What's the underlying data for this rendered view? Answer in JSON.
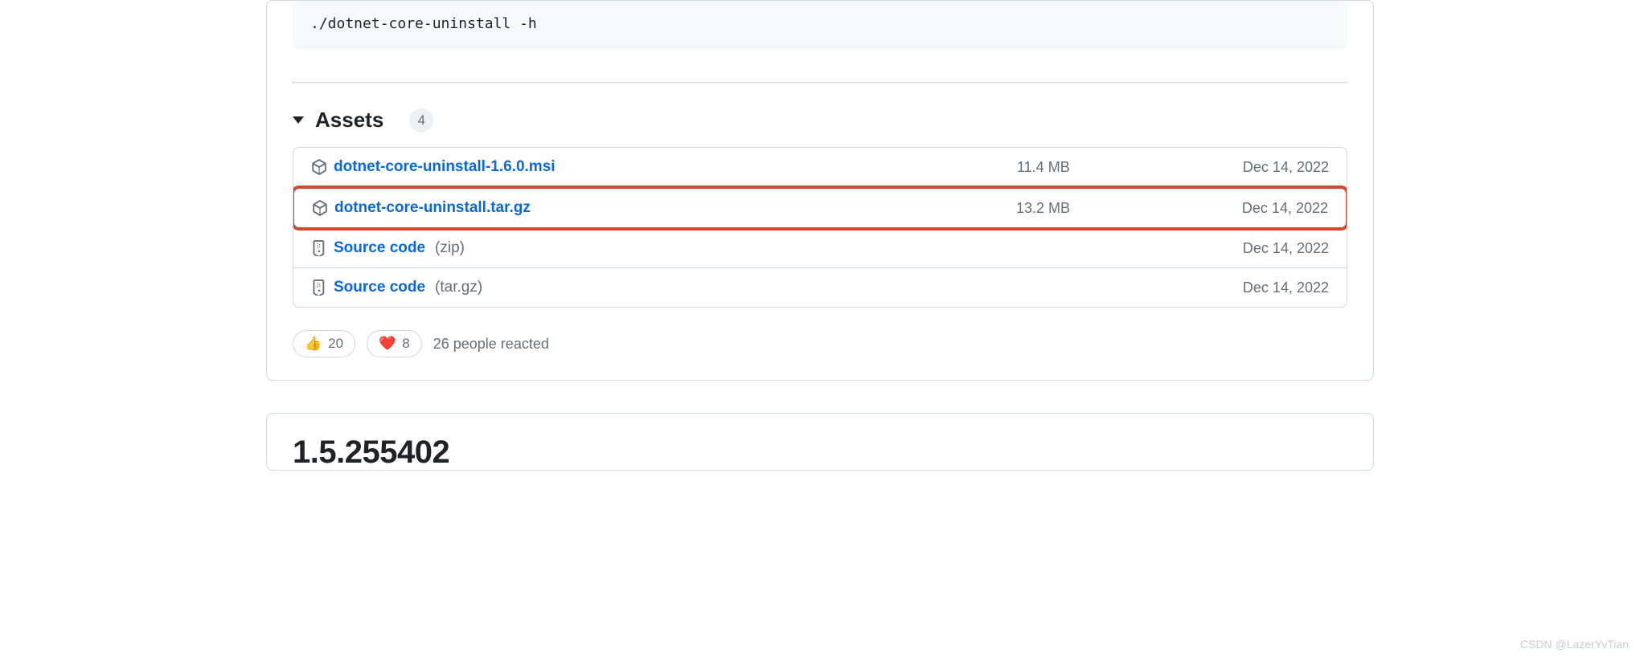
{
  "codeblock": {
    "line": "./dotnet-core-uninstall -h"
  },
  "assets": {
    "title": "Assets",
    "count": "4",
    "items": [
      {
        "name": "dotnet-core-uninstall-1.6.0.msi",
        "size": "11.4 MB",
        "date": "Dec 14, 2022",
        "icon": "package",
        "highlighted": false
      },
      {
        "name": "dotnet-core-uninstall.tar.gz",
        "size": "13.2 MB",
        "date": "Dec 14, 2022",
        "icon": "package",
        "highlighted": true
      },
      {
        "name": "Source code",
        "suffix": "(zip)",
        "size": "",
        "date": "Dec 14, 2022",
        "icon": "zip",
        "highlighted": false
      },
      {
        "name": "Source code",
        "suffix": "(tar.gz)",
        "size": "",
        "date": "Dec 14, 2022",
        "icon": "zip",
        "highlighted": false
      }
    ]
  },
  "reactions": {
    "items": [
      {
        "emoji": "👍",
        "count": "20"
      },
      {
        "emoji": "❤️",
        "count": "8"
      }
    ],
    "summary": "26 people reacted"
  },
  "next_release": {
    "title": "1.5.255402"
  },
  "watermark": "CSDN @LazerYvTian"
}
